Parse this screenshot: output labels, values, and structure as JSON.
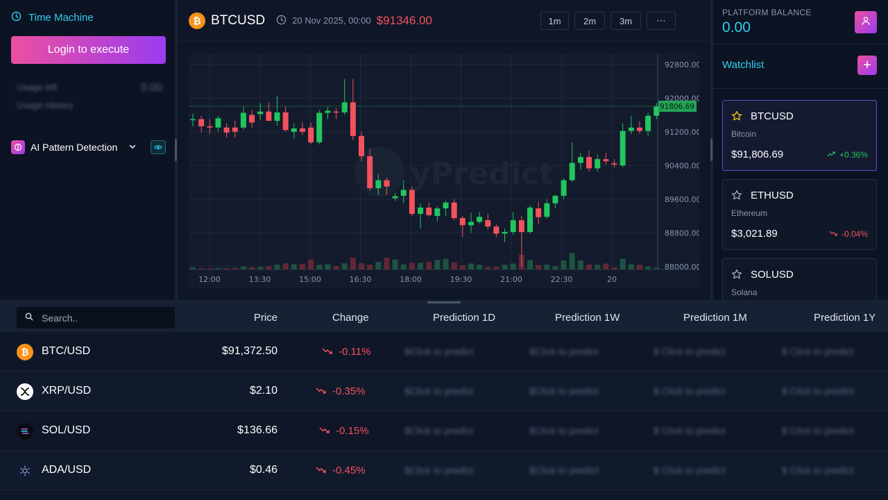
{
  "sidebar": {
    "time_machine_label": "Time Machine",
    "login_label": "Login to execute",
    "usage_left_label": "Usage left",
    "usage_left_value": "0.00",
    "usage_history_label": "Usage History",
    "ai_pattern_label": "AI Pattern Detection"
  },
  "chart_header": {
    "symbol": "BTCUSD",
    "coin_glyph": "₿",
    "datetime": "20 Nov 2025, 00:00",
    "price": "$91346.00",
    "timeframes": [
      "1m",
      "2m",
      "3m",
      "⋯"
    ]
  },
  "chart_data": {
    "type": "candlestick",
    "watermark": "yPredict",
    "last_price_label": "91806.69",
    "last_price": 91806.69,
    "y_ticks": [
      "92800.00",
      "92000.00",
      "91200.00",
      "90400.00",
      "89600.00",
      "88800.00",
      "88000.00"
    ],
    "y_tick_values": [
      92800,
      92000,
      91200,
      90400,
      89600,
      88800,
      88000
    ],
    "ylim": [
      87930,
      93060
    ],
    "x_ticks": [
      "12:00",
      "13:30",
      "15:00",
      "16:30",
      "18:00",
      "19:30",
      "21:00",
      "22:30",
      "20"
    ],
    "candles": [
      {
        "o": 91500,
        "h": 91630,
        "l": 91330,
        "c": 91500
      },
      {
        "o": 91500,
        "h": 91580,
        "l": 91180,
        "c": 91330
      },
      {
        "o": 91330,
        "h": 91500,
        "l": 91150,
        "c": 91300
      },
      {
        "o": 91300,
        "h": 91580,
        "l": 91200,
        "c": 91520
      },
      {
        "o": 91300,
        "h": 91400,
        "l": 91060,
        "c": 91180
      },
      {
        "o": 91300,
        "h": 91460,
        "l": 91060,
        "c": 91200
      },
      {
        "o": 91300,
        "h": 91800,
        "l": 91250,
        "c": 91650
      },
      {
        "o": 91600,
        "h": 91720,
        "l": 91300,
        "c": 91420
      },
      {
        "o": 91620,
        "h": 91880,
        "l": 91480,
        "c": 91680
      },
      {
        "o": 91680,
        "h": 91900,
        "l": 91500,
        "c": 91460
      },
      {
        "o": 91460,
        "h": 92050,
        "l": 91350,
        "c": 91660
      },
      {
        "o": 91660,
        "h": 91800,
        "l": 91200,
        "c": 91240
      },
      {
        "o": 91200,
        "h": 91400,
        "l": 91030,
        "c": 91280
      },
      {
        "o": 91280,
        "h": 91420,
        "l": 91120,
        "c": 91200
      },
      {
        "o": 91300,
        "h": 91420,
        "l": 90900,
        "c": 90950
      },
      {
        "o": 90950,
        "h": 91720,
        "l": 90900,
        "c": 91650
      },
      {
        "o": 91650,
        "h": 91800,
        "l": 91500,
        "c": 91700
      },
      {
        "o": 91680,
        "h": 91760,
        "l": 91500,
        "c": 91660
      },
      {
        "o": 91660,
        "h": 92450,
        "l": 91600,
        "c": 91900
      },
      {
        "o": 91900,
        "h": 92450,
        "l": 91000,
        "c": 91100
      },
      {
        "o": 91100,
        "h": 91200,
        "l": 90500,
        "c": 90620
      },
      {
        "o": 90620,
        "h": 90800,
        "l": 89800,
        "c": 89860
      },
      {
        "o": 89860,
        "h": 90200,
        "l": 89700,
        "c": 90050
      },
      {
        "o": 90050,
        "h": 90100,
        "l": 89700,
        "c": 89900
      },
      {
        "o": 89620,
        "h": 89750,
        "l": 89560,
        "c": 89670
      },
      {
        "o": 89680,
        "h": 90050,
        "l": 89500,
        "c": 89820
      },
      {
        "o": 89820,
        "h": 89900,
        "l": 89200,
        "c": 89250
      },
      {
        "o": 89250,
        "h": 89500,
        "l": 88900,
        "c": 89400
      },
      {
        "o": 89400,
        "h": 89520,
        "l": 89180,
        "c": 89220
      },
      {
        "o": 89200,
        "h": 89420,
        "l": 89080,
        "c": 89380
      },
      {
        "o": 89380,
        "h": 89560,
        "l": 89200,
        "c": 89520
      },
      {
        "o": 89520,
        "h": 89600,
        "l": 89100,
        "c": 89150
      },
      {
        "o": 89150,
        "h": 89200,
        "l": 88700,
        "c": 88980
      },
      {
        "o": 88980,
        "h": 89280,
        "l": 88800,
        "c": 89060
      },
      {
        "o": 89060,
        "h": 89300,
        "l": 89020,
        "c": 89180
      },
      {
        "o": 89100,
        "h": 89250,
        "l": 88880,
        "c": 88950
      },
      {
        "o": 88950,
        "h": 89000,
        "l": 88700,
        "c": 88780
      },
      {
        "o": 88780,
        "h": 88900,
        "l": 88580,
        "c": 88820
      },
      {
        "o": 88820,
        "h": 89300,
        "l": 88750,
        "c": 89100
      },
      {
        "o": 89100,
        "h": 89200,
        "l": 88000,
        "c": 88820
      },
      {
        "o": 88820,
        "h": 89450,
        "l": 88780,
        "c": 89400
      },
      {
        "o": 89380,
        "h": 89550,
        "l": 89000,
        "c": 89170
      },
      {
        "o": 89180,
        "h": 89600,
        "l": 89130,
        "c": 89500
      },
      {
        "o": 89500,
        "h": 89700,
        "l": 89380,
        "c": 89680
      },
      {
        "o": 89680,
        "h": 90100,
        "l": 89600,
        "c": 90050
      },
      {
        "o": 90050,
        "h": 90950,
        "l": 90000,
        "c": 90460
      },
      {
        "o": 90460,
        "h": 90700,
        "l": 90300,
        "c": 90600
      },
      {
        "o": 90600,
        "h": 90750,
        "l": 90250,
        "c": 90330
      },
      {
        "o": 90330,
        "h": 90650,
        "l": 90250,
        "c": 90550
      },
      {
        "o": 90550,
        "h": 90700,
        "l": 90420,
        "c": 90500
      },
      {
        "o": 90450,
        "h": 90550,
        "l": 90350,
        "c": 90420
      },
      {
        "o": 90400,
        "h": 91400,
        "l": 90360,
        "c": 91220
      },
      {
        "o": 91220,
        "h": 91580,
        "l": 91150,
        "c": 91300
      },
      {
        "o": 91300,
        "h": 91450,
        "l": 91150,
        "c": 91220
      },
      {
        "o": 91220,
        "h": 91650,
        "l": 91100,
        "c": 91580
      },
      {
        "o": 91580,
        "h": 91880,
        "l": 91500,
        "c": 91800
      }
    ],
    "volumes": [
      0.08,
      0.05,
      0.04,
      0.06,
      0.05,
      0.07,
      0.12,
      0.09,
      0.1,
      0.13,
      0.2,
      0.26,
      0.22,
      0.24,
      0.42,
      0.2,
      0.22,
      0.14,
      0.26,
      0.5,
      0.26,
      0.2,
      0.32,
      0.5,
      0.42,
      0.22,
      0.28,
      0.28,
      0.32,
      0.4,
      0.45,
      0.3,
      0.18,
      0.25,
      0.2,
      0.1,
      0.12,
      0.2,
      0.25,
      0.62,
      0.4,
      0.18,
      0.2,
      0.14,
      0.38,
      0.7,
      0.38,
      0.2,
      0.2,
      0.25,
      0.08,
      0.45,
      0.22,
      0.2,
      0.12,
      0.07
    ]
  },
  "right_panel": {
    "platform_balance_label": "PLATFORM BALANCE",
    "platform_balance_value": "0.00",
    "watchlist_title": "Watchlist",
    "items": [
      {
        "symbol": "BTCUSD",
        "name": "Bitcoin",
        "price": "$91,806.69",
        "change": "+0.36%",
        "active": true,
        "up": true
      },
      {
        "symbol": "ETHUSD",
        "name": "Ethereum",
        "price": "$3,021.89",
        "change": "-0.04%",
        "active": false,
        "up": false
      },
      {
        "symbol": "SOLUSD",
        "name": "Solana",
        "price": "",
        "change": "",
        "active": false,
        "up": false
      }
    ]
  },
  "table": {
    "search_placeholder": "Search..",
    "headers": [
      "Price",
      "Change",
      "Prediction 1D",
      "Prediction 1W",
      "Prediction 1M",
      "Prediction 1Y"
    ],
    "rows": [
      {
        "pair": "BTC/USD",
        "price": "$91,372.50",
        "change": "-0.11%",
        "pred": [
          "$Click to predict",
          "$Click to predict",
          "$ Click to predict",
          "$ Click to predict"
        ]
      },
      {
        "pair": "XRP/USD",
        "price": "$2.10",
        "change": "-0.35%",
        "pred": [
          "$Click to predict",
          "$Click to predict",
          "$ Click to predict",
          "$ Click to predict"
        ]
      },
      {
        "pair": "SOL/USD",
        "price": "$136.66",
        "change": "-0.15%",
        "pred": [
          "$Click to predict",
          "$Click to predict",
          "$ Click to predict",
          "$ Click to predict"
        ]
      },
      {
        "pair": "ADA/USD",
        "price": "$0.46",
        "change": "-0.45%",
        "pred": [
          "$Click to predict",
          "$Click to predict",
          "$ Click to predict",
          "$ Click to predict"
        ]
      }
    ]
  },
  "colors": {
    "accent_cyan": "#2fd0f0",
    "up_green": "#22c55e",
    "down_red": "#f3525d",
    "gradient_pink": "#ec4fa0",
    "gradient_purple": "#9b3cf0"
  }
}
